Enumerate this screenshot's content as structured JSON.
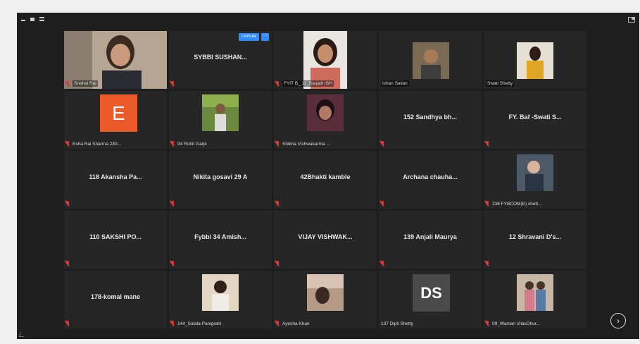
{
  "toolbar": {
    "unmute_label": "Unmute",
    "more_label": "···",
    "next_label": "›"
  },
  "tiles": [
    {
      "caption": "Snehal Rai",
      "video": true,
      "muted": true
    },
    {
      "name": "SYBBI SUSHAN...",
      "muted": true
    },
    {
      "caption": "FYIT B_ 11_Baujah ISH",
      "video": true,
      "muted": true
    },
    {
      "caption": "Ishan Salian",
      "video": true,
      "muted": false
    },
    {
      "caption": "Swati Shetty",
      "video": true,
      "muted": false
    },
    {
      "caption": "Esha Rai Sharma 240...",
      "avatar": "E",
      "muted": true
    },
    {
      "caption": "94 Rohit Garje",
      "video": true,
      "muted": true
    },
    {
      "caption": "Shikha Vishwakarma ...",
      "video": true,
      "muted": true
    },
    {
      "name": "152 Sandhya bh...",
      "muted": true
    },
    {
      "name": "FY. Baf -Swati S...",
      "muted": true
    },
    {
      "name": "118 Akansha Pa...",
      "muted": true
    },
    {
      "name": "Nikita gosavi 29 A",
      "muted": true
    },
    {
      "name": "42Bhakti kamble",
      "muted": true
    },
    {
      "name": "Archana chauha...",
      "muted": true
    },
    {
      "caption": "238 FYBCOM(E) shett...",
      "video": true,
      "muted": true
    },
    {
      "name": "110 SAKSHI PO...",
      "muted": true
    },
    {
      "name": "Fybbi 34 Amish...",
      "muted": true
    },
    {
      "name": "VIJAY VISHWAK...",
      "muted": true
    },
    {
      "name": "139 Anjali Maurya",
      "muted": true
    },
    {
      "name": "12 Shravani D's...",
      "muted": true
    },
    {
      "name": "178-komal mane",
      "muted": true
    },
    {
      "caption": "144_Sulata Panigrahi",
      "video": true,
      "muted": true
    },
    {
      "caption": "Ayesha Khan",
      "video": true,
      "muted": true
    },
    {
      "caption": "137 Dipti Shetty",
      "avatar": "DS",
      "muted": false
    },
    {
      "caption": "09_Waman VilasDhur...",
      "video": true,
      "muted": true
    }
  ]
}
